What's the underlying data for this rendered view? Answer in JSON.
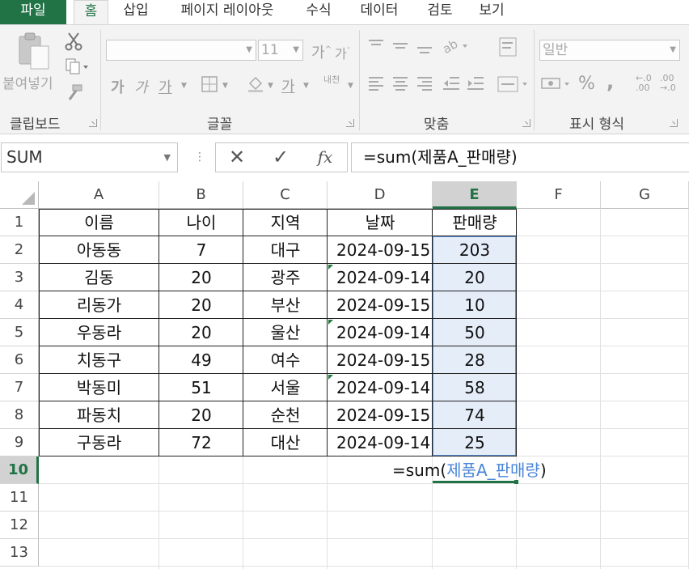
{
  "tabs": [
    {
      "id": "file",
      "label": "파일"
    },
    {
      "id": "home",
      "label": "홈"
    },
    {
      "id": "insert",
      "label": "삽입"
    },
    {
      "id": "layout",
      "label": "페이지 레이아웃"
    },
    {
      "id": "formulas",
      "label": "수식"
    },
    {
      "id": "data",
      "label": "데이터"
    },
    {
      "id": "review",
      "label": "검토"
    },
    {
      "id": "view",
      "label": "보기"
    }
  ],
  "ribbon": {
    "clipboard": {
      "paste_label": "붙여넣기",
      "group_label": "클립보드"
    },
    "font": {
      "font_name": "",
      "font_size": "11",
      "bold": "가",
      "italic": "가",
      "underline": "가",
      "font_color_glyph": "가",
      "phonetic": "내천",
      "grow": "가",
      "shrink": "가",
      "group_label": "글꼴"
    },
    "alignment": {
      "group_label": "맞춤"
    },
    "number": {
      "format": "일반",
      "percent": "%",
      "comma": ",",
      "inc_decimal": "←.0\n.00",
      "dec_decimal": ".00\n→.0",
      "group_label": "표시 형식"
    }
  },
  "formula_bar": {
    "name_box": "SUM",
    "cancel": "✕",
    "enter": "✓",
    "fx": "fx",
    "formula": "=sum(제품A_판매량)"
  },
  "sheet": {
    "columns": [
      "A",
      "B",
      "C",
      "D",
      "E",
      "F",
      "G"
    ],
    "rows": [
      "1",
      "2",
      "3",
      "4",
      "5",
      "6",
      "7",
      "8",
      "9",
      "10",
      "11",
      "12",
      "13"
    ],
    "headers": [
      "이름",
      "나이",
      "지역",
      "날짜",
      "판매량"
    ],
    "data": [
      [
        "아동동",
        "7",
        "대구",
        "2024-09-15",
        "203"
      ],
      [
        "김동",
        "20",
        "광주",
        "2024-09-14",
        "20"
      ],
      [
        "리동가",
        "20",
        "부산",
        "2024-09-15",
        "10"
      ],
      [
        "우동라",
        "20",
        "울산",
        "2024-09-14",
        "50"
      ],
      [
        "치동구",
        "49",
        "여수",
        "2024-09-15",
        "28"
      ],
      [
        "박동미",
        "51",
        "서울",
        "2024-09-14",
        "58"
      ],
      [
        "파동치",
        "20",
        "순천",
        "2024-09-15",
        "74"
      ],
      [
        "구동라",
        "72",
        "대산",
        "2024-09-14",
        "25"
      ]
    ],
    "edit_cell": {
      "prefix": "=sum(",
      "ref": "제품A_판매량",
      "suffix": ")"
    },
    "selected_column": "E",
    "selected_row": "10"
  },
  "colors": {
    "accent": "#217346",
    "selection_border": "#5b8fd6",
    "ref_text": "#4a86d8"
  }
}
